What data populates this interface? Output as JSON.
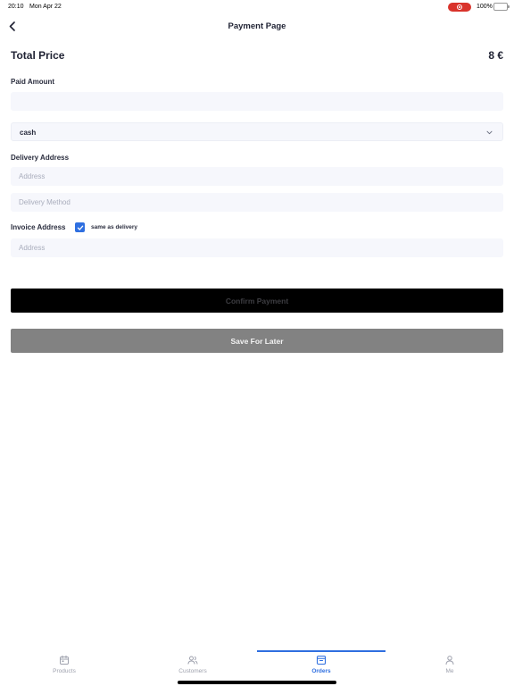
{
  "status_bar": {
    "time": "20:10",
    "date": "Mon Apr 22",
    "battery": "100%",
    "battery_level": 1.0
  },
  "header": {
    "title": "Payment Page",
    "back_icon": "chevron-left-icon"
  },
  "summary": {
    "total_label": "Total Price",
    "total_value": "8 €"
  },
  "form": {
    "paid_amount_label": "Paid Amount",
    "paid_amount_value": "",
    "payment_method_value": "cash",
    "delivery_address_label": "Delivery Address",
    "delivery_address_placeholder": "Address",
    "delivery_method_placeholder": "Delivery Method",
    "invoice_address_label": "Invoice Address",
    "same_as_delivery_label": "same as delivery",
    "same_as_delivery_checked": true,
    "invoice_address_placeholder": "Address"
  },
  "buttons": {
    "confirm_label": "Confirm Payment",
    "save_label": "Save For Later"
  },
  "tabs": [
    {
      "label": "Products",
      "icon": "calendar-icon",
      "active": false
    },
    {
      "label": "Customers",
      "icon": "users-icon",
      "active": false
    },
    {
      "label": "Orders",
      "icon": "archive-icon",
      "active": true
    },
    {
      "label": "Me",
      "icon": "user-icon",
      "active": false
    }
  ],
  "colors": {
    "accent": "#2f6fe0",
    "confirm_bg": "#000000",
    "save_bg": "#828282",
    "record_indicator": "#d9332b",
    "battery": "#3cc84a"
  }
}
